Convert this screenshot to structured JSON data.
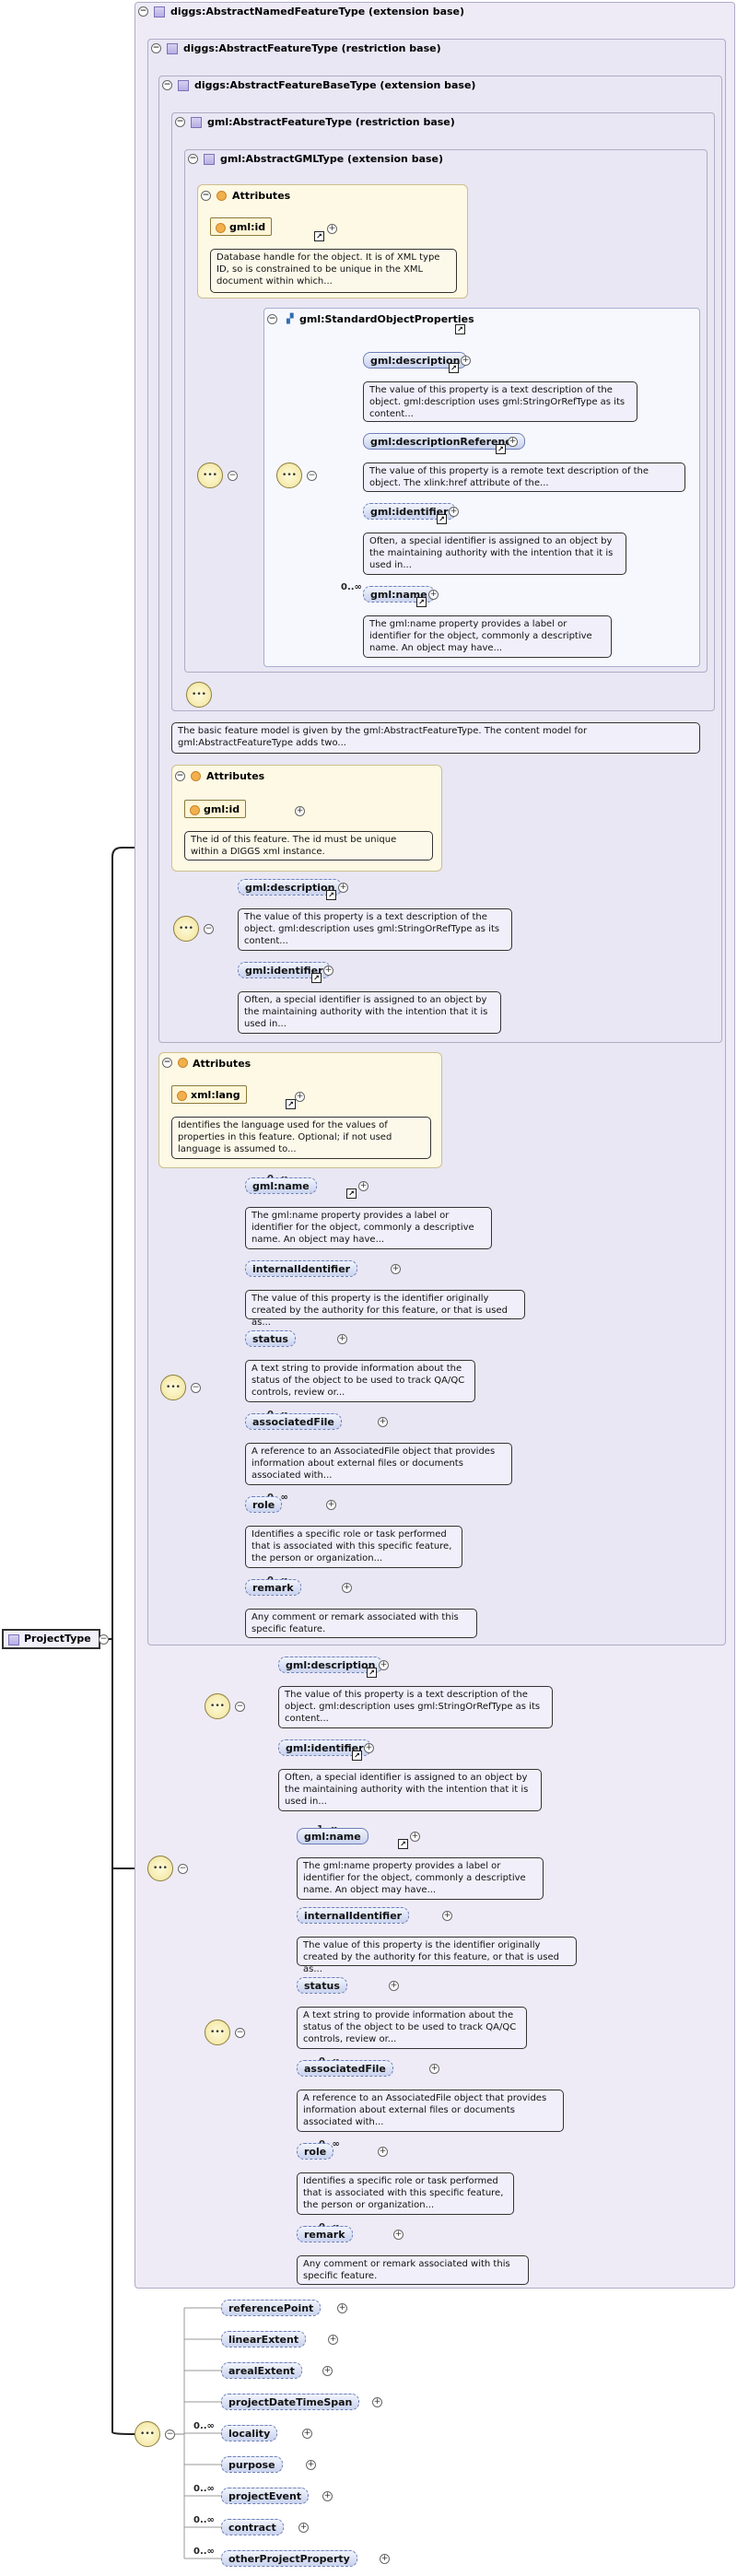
{
  "diagram": {
    "root": {
      "label": "ProjectType"
    },
    "boxes": {
      "named": "diggs:AbstractNamedFeatureType (extension base)",
      "feature": "diggs:AbstractFeatureType (restriction base)",
      "featurebase": "diggs:AbstractFeatureBaseType (extension base)",
      "gmlfeature": "gml:AbstractFeatureType (restriction base)",
      "gmltype": "gml:AbstractGMLType (extension base)",
      "stdprops": "gml:StandardObjectProperties"
    },
    "attributes_heading": "Attributes",
    "attrs": {
      "gmlid1": {
        "label": "gml:id",
        "doc": "Database handle for the object. It is of XML type ID, so is constrained to be unique in the XML document within which..."
      },
      "gmlid2": {
        "label": "gml:id",
        "doc": "The id of this feature. The id must be unique within a DIGGS xml instance."
      },
      "xmllang": {
        "label": "xml:lang",
        "doc": "Identifies the language used for the values of properties in this feature. Optional; if not used language is assumed to..."
      }
    },
    "featurebase_doc": "The basic feature model is given by the gml:AbstractFeatureType. The content model for gml:AbstractFeatureType adds two...",
    "elements": {
      "std_description": {
        "label": "gml:description",
        "doc": "The value of this property is a text description of the object. gml:description uses gml:StringOrRefType as its content..."
      },
      "std_descref": {
        "label": "gml:descriptionReference",
        "doc": "The value of this property is a remote text description of the object. The xlink:href attribute of the..."
      },
      "std_identifier": {
        "label": "gml:identifier",
        "doc": "Often, a special identifier is assigned to an object by the maintaining authority with the intention that it is used in..."
      },
      "std_name": {
        "label": "gml:name",
        "doc": "The gml:name property provides a label or identifier for the object, commonly a descriptive name. An object may have..."
      },
      "fb_description": {
        "label": "gml:description",
        "doc": "The value of this property is a text description of the object. gml:description uses gml:StringOrRefType as its content..."
      },
      "fb_identifier": {
        "label": "gml:identifier",
        "doc": "Often, a special identifier is assigned to an object by the maintaining authority with the intention that it is used in..."
      },
      "nf_name": {
        "label": "gml:name",
        "doc": "The gml:name property provides a label or identifier for the object, commonly a descriptive name. An object may have..."
      },
      "nf_internal": {
        "label": "internalIdentifier",
        "doc": "The value of this property is the identifier originally created by the authority for this feature, or that is used as..."
      },
      "nf_status": {
        "label": "status",
        "doc": "A text string to provide information about the status of the object to be used to track QA/QC controls, review or..."
      },
      "nf_assoc": {
        "label": "associatedFile",
        "doc": "A reference to an AssociatedFile object that provides information about external files or documents associated with..."
      },
      "nf_role": {
        "label": "role",
        "doc": "Identifies a specific role or task performed that is associated with this specific feature, the person or organization..."
      },
      "nf_remark": {
        "label": "remark",
        "doc": "Any comment or remark associated with this specific feature."
      },
      "r_description": {
        "label": "gml:description",
        "doc": "The value of this property is a text description of the object. gml:description uses gml:StringOrRefType as its content..."
      },
      "r_identifier": {
        "label": "gml:identifier",
        "doc": "Often, a special identifier is assigned to an object by the maintaining authority with the intention that it is used in..."
      },
      "r_name": {
        "label": "gml:name",
        "doc": "The gml:name property provides a label or identifier for the object, commonly a descriptive name. An object may have..."
      },
      "r_internal": {
        "label": "internalIdentifier",
        "doc": "The value of this property is the identifier originally created by the authority for this feature, or that is used as..."
      },
      "r_status": {
        "label": "status",
        "doc": "A text string to provide information about the status of the object to be used to track QA/QC controls, review or..."
      },
      "r_assoc": {
        "label": "associatedFile",
        "doc": "A reference to an AssociatedFile object that provides information about external files or documents associated with..."
      },
      "r_role": {
        "label": "role",
        "doc": "Identifies a specific role or task performed that is associated with this specific feature, the person or organization..."
      },
      "r_remark": {
        "label": "remark",
        "doc": "Any comment or remark associated with this specific feature."
      },
      "p_refpoint": {
        "label": "referencePoint"
      },
      "p_linear": {
        "label": "linearExtent"
      },
      "p_areal": {
        "label": "arealExtent"
      },
      "p_datetime": {
        "label": "projectDateTimeSpan"
      },
      "p_locality": {
        "label": "locality"
      },
      "p_purpose": {
        "label": "purpose"
      },
      "p_event": {
        "label": "projectEvent"
      },
      "p_contract": {
        "label": "contract"
      },
      "p_other": {
        "label": "otherProjectProperty"
      }
    },
    "occurrences": {
      "zero_many": "0..∞",
      "one_many": "1..∞"
    }
  }
}
